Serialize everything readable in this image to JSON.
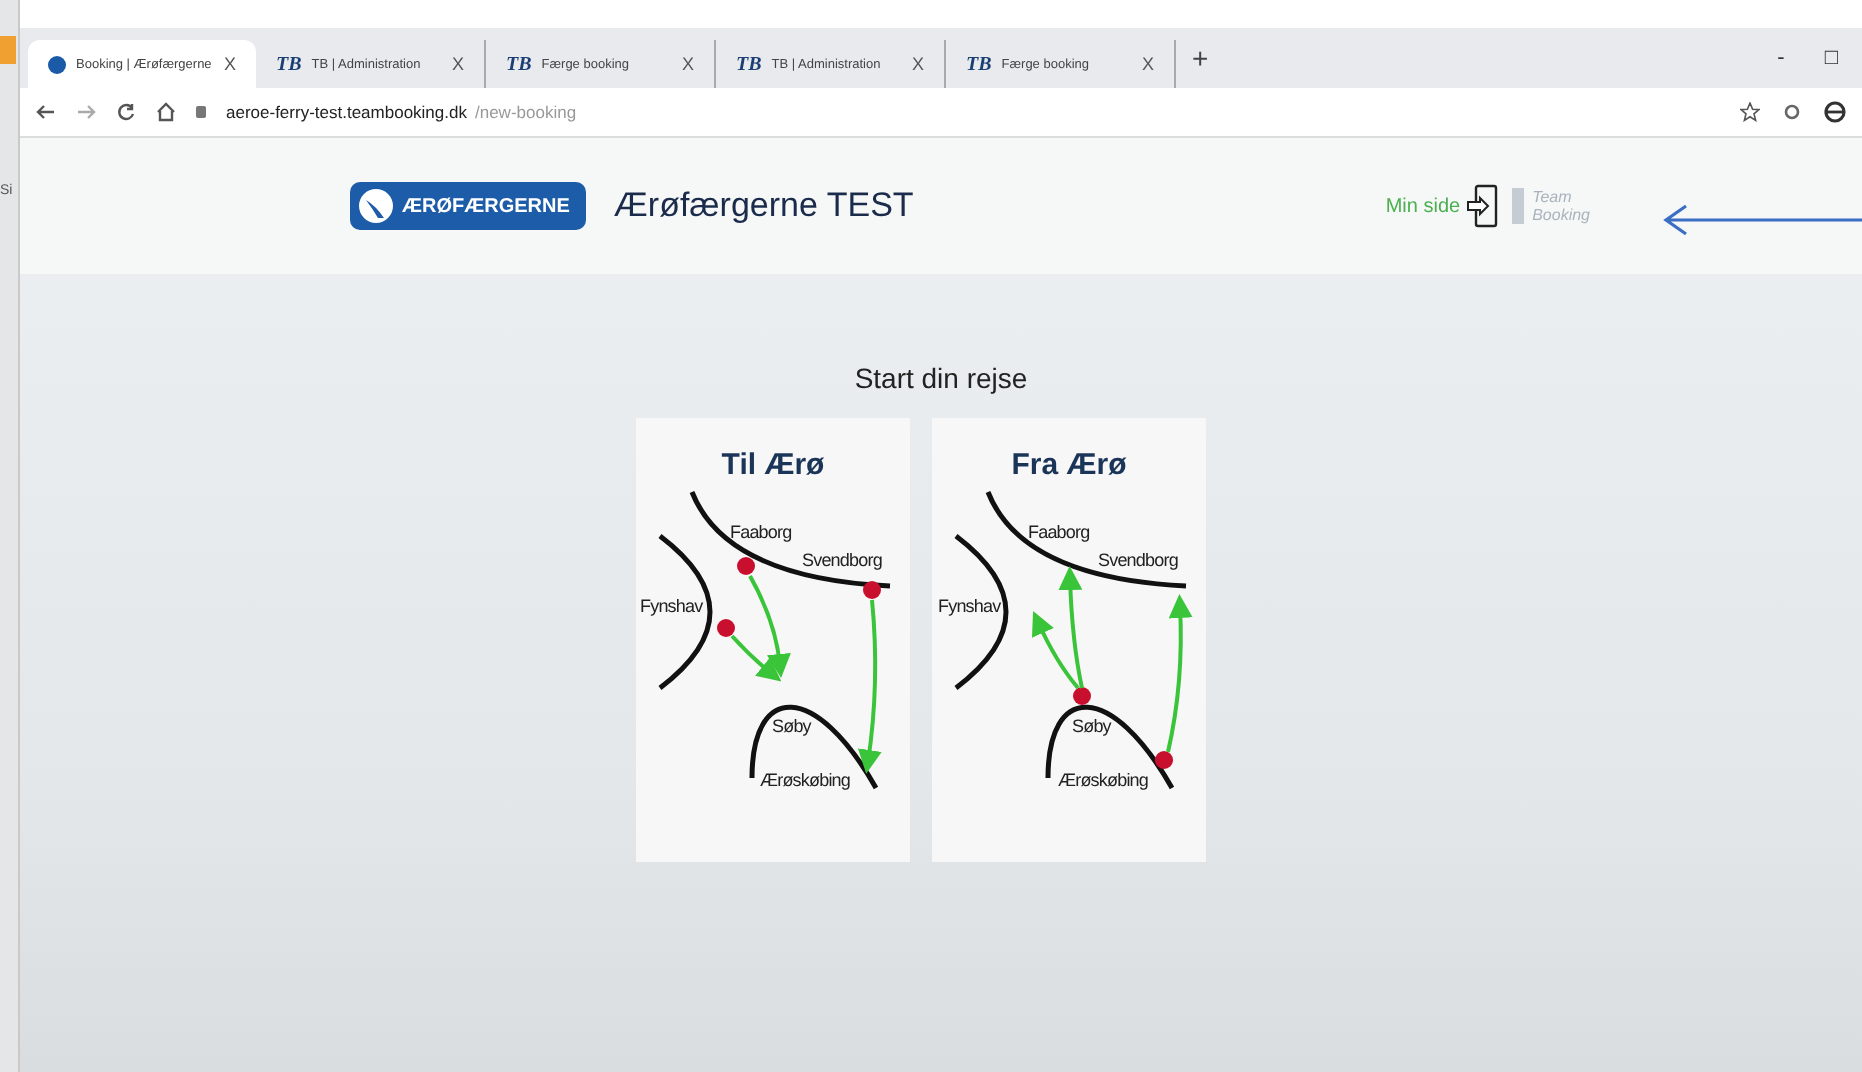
{
  "background_window": {
    "text": "Si"
  },
  "tabs": [
    {
      "kind": "globe",
      "label": "Booking | Ærøfærgerne",
      "close": "X",
      "selected": true
    },
    {
      "kind": "logo",
      "logo": "TB",
      "label": "TB | Administration",
      "close": "X",
      "selected": false
    },
    {
      "kind": "logo",
      "logo": "TB",
      "label": "Færge booking",
      "close": "X",
      "selected": false
    },
    {
      "kind": "logo",
      "logo": "TB",
      "label": "TB | Administration",
      "close": "X",
      "selected": false
    },
    {
      "kind": "logo",
      "logo": "TB",
      "label": "Færge booking",
      "close": "X",
      "selected": false
    }
  ],
  "new_tab": "+",
  "window_controls": [
    "-",
    "□"
  ],
  "address_bar": {
    "host": "aeroe-ferry-test.teambooking.dk",
    "path": "/new-booking"
  },
  "header": {
    "logo_text": "ÆRØFÆRGERNE",
    "title": "Ærøfærgerne TEST",
    "my_page": "Min side",
    "brand_top": "Team",
    "brand_bottom": "Booking"
  },
  "heading": "Start din rejse",
  "cards": [
    {
      "kind": "to_aero",
      "title": "Til Ærø",
      "places": [
        "Faaborg",
        "Svendborg",
        "Fynshav",
        "Søby",
        "Ærøskøbing"
      ]
    },
    {
      "kind": "from_aero",
      "title": "Fra Ærø",
      "places": [
        "Faaborg",
        "Svendborg",
        "Fynshav",
        "Søby",
        "Ærøskøbing"
      ]
    }
  ]
}
